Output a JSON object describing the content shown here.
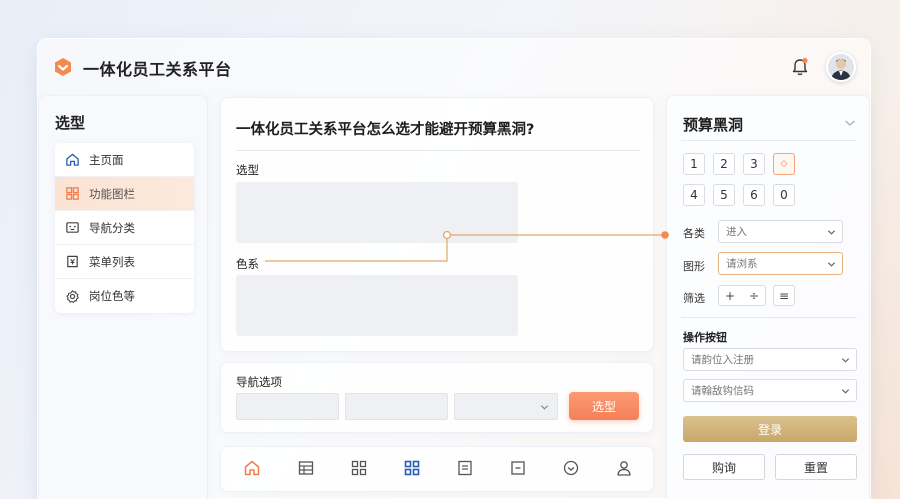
{
  "header": {
    "app_title": "一体化员工关系平台",
    "logo_icon": "orange-hexagon-logo",
    "notification_icon": "bell-icon",
    "avatar": "user-avatar"
  },
  "sidebar": {
    "title": "选型",
    "items": [
      {
        "label": "主页面",
        "icon": "home-icon",
        "active": false
      },
      {
        "label": "功能图栏",
        "icon": "grid-icon",
        "active": true
      },
      {
        "label": "导航分类",
        "icon": "navigation-icon",
        "active": false
      },
      {
        "label": "菜单列表",
        "icon": "menu-list-icon",
        "active": false
      },
      {
        "label": "岗位色等",
        "icon": "gear-icon",
        "active": false
      }
    ]
  },
  "main": {
    "title": "一体化员工关系平台怎么选才能避开预算黑洞?",
    "field1_label": "选型",
    "field2_label": "色系"
  },
  "nav_options": {
    "title": "导航选项",
    "button_label": "选型"
  },
  "tabbar": {
    "icons": [
      "home-icon",
      "list-icon",
      "grid-icon",
      "grid-active-icon",
      "document-icon",
      "box-icon",
      "circle-check-icon",
      "user-icon"
    ]
  },
  "right_panel": {
    "title": "预算黑洞",
    "keys_row1": [
      "1",
      "2",
      "3",
      "◇"
    ],
    "keys_row2": [
      "4",
      "5",
      "6",
      "0"
    ],
    "rows": [
      {
        "label": "各类",
        "value": "进入"
      },
      {
        "label": "图形",
        "value": "请浏系"
      },
      {
        "label": "筛选"
      }
    ],
    "filter_buttons": [
      "+",
      "÷",
      "≡"
    ],
    "section_title": "操作按钮",
    "selects": [
      "请韵位入注册",
      "请翰敌钩信码"
    ],
    "login_label": "登录",
    "query_label": "购询",
    "reset_label": "重置"
  },
  "colors": {
    "accent": "#f58059",
    "gold": "#c8a868",
    "connector": "#e0a86a"
  }
}
